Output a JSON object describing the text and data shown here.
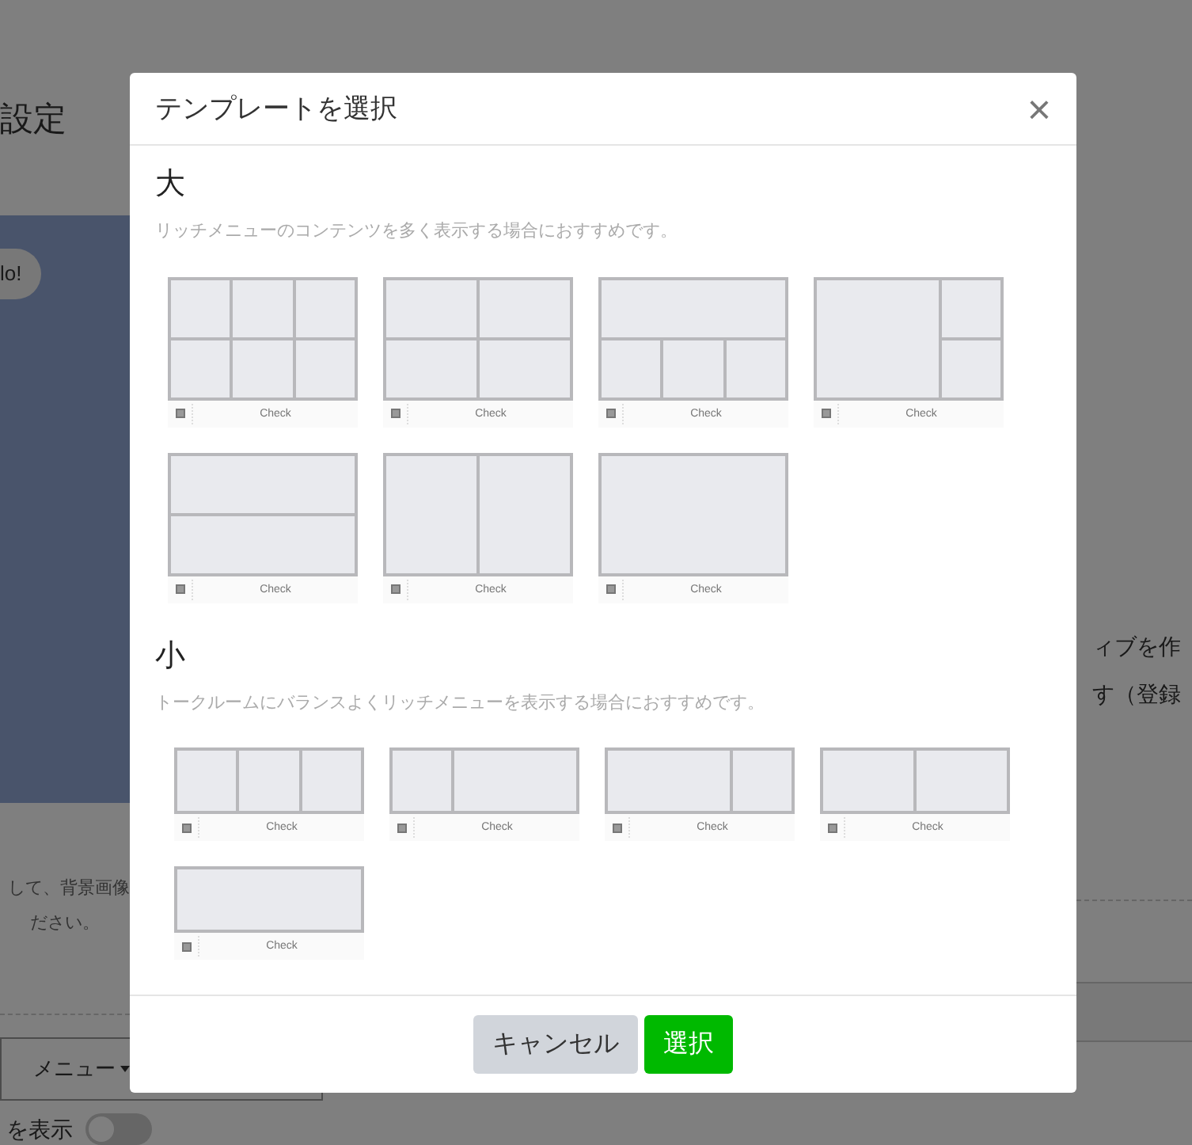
{
  "background_page": {
    "heading": "設定",
    "bubble": "lo!",
    "instruction_lines": [
      "して、背景画像",
      "ださい。"
    ],
    "menu_dropdown": "メニュー",
    "toggle": {
      "label": "を表示",
      "on": false
    },
    "right_lines": [
      "ィブを作",
      "す（登録"
    ]
  },
  "dialog": {
    "title": "テンプレートを選択",
    "close": "×",
    "sections": [
      {
        "heading": "大",
        "description": "リッチメニューのコンテンツを多く表示する場合におすすめです。",
        "kind": "large",
        "templates": [
          {
            "kind": "grid-3x2",
            "label": "Check"
          },
          {
            "kind": "grid-2x2",
            "label": "Check"
          },
          {
            "kind": "top1-bottom3",
            "label": "Check"
          },
          {
            "kind": "left-large-right2",
            "label": "Check"
          },
          {
            "kind": "rows-2",
            "label": "Check"
          },
          {
            "kind": "cols-2",
            "label": "Check"
          },
          {
            "kind": "single",
            "label": "Check"
          }
        ]
      },
      {
        "heading": "小",
        "description": "トークルームにバランスよくリッチメニューを表示する場合におすすめです。",
        "kind": "compact",
        "templates": [
          {
            "kind": "cols-3",
            "label": "Check"
          },
          {
            "kind": "narrow-wide",
            "label": "Check"
          },
          {
            "kind": "wide-narrow",
            "label": "Check"
          },
          {
            "kind": "cols-2",
            "label": "Check"
          },
          {
            "kind": "single",
            "label": "Check"
          }
        ]
      }
    ],
    "buttons": [
      {
        "kind": "secondary",
        "label": "キャンセル"
      },
      {
        "kind": "primary",
        "label": "選択"
      }
    ]
  }
}
